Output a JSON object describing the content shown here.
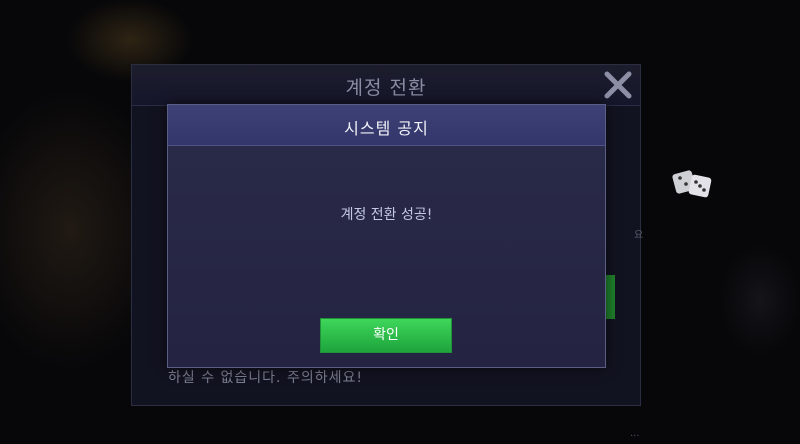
{
  "outer_panel": {
    "title": "계정 전환",
    "close_icon": "close-icon",
    "warning_text": "하실 수 없습니다. 주의하세요!",
    "side_text": "요",
    "bottom_right_text": "..."
  },
  "dialog": {
    "title": "시스템 공지",
    "message": "계정 전환 성공!",
    "confirm_label": "확인"
  },
  "colors": {
    "accent_green": "#2fbf4a",
    "dialog_header": "#3a3d70",
    "dialog_body": "#272745"
  }
}
